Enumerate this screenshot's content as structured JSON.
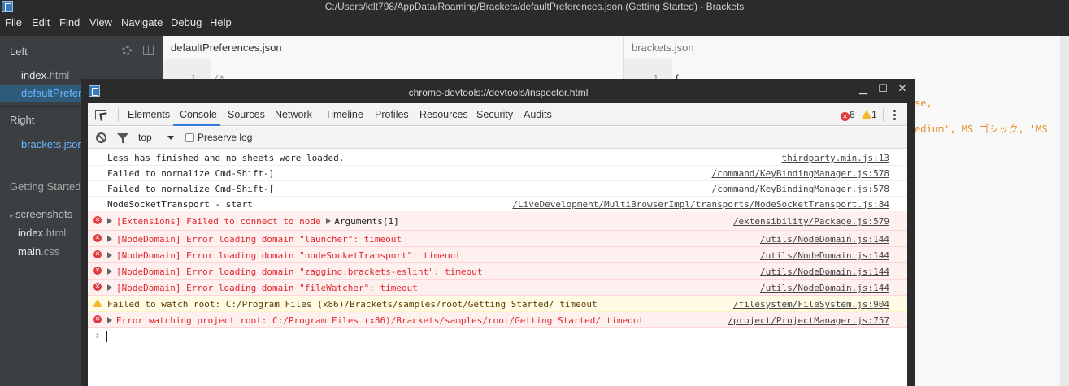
{
  "app": {
    "window_title": "C:/Users/ktlt798/AppData/Roaming/Brackets/defaultPreferences.json (Getting Started) - Brackets",
    "menu": [
      "File",
      "Edit",
      "Find",
      "View",
      "Navigate",
      "Debug",
      "Help"
    ]
  },
  "sidebar": {
    "left_header": "Left",
    "left_files": [
      {
        "name": "index",
        "ext": ".html"
      },
      {
        "name": "defaultPrefer",
        "ext": ""
      }
    ],
    "right_header": "Right",
    "right_files": [
      {
        "name": "brackets.json",
        "ext": ""
      }
    ],
    "project_name": "Getting Started",
    "tree": [
      {
        "name": "screenshots",
        "ext": ""
      },
      {
        "name": "index",
        "ext": ".html"
      },
      {
        "name": "main",
        "ext": ".css"
      }
    ]
  },
  "editor": {
    "left_tab": "defaultPreferences.json",
    "right_tab": "brackets.json",
    "left_line_number": "1",
    "left_code_start": "/*",
    "right_line_number": "1",
    "right_code_start": "{",
    "right_snippet_1": "se,",
    "right_snippet_2": "edium', MS ゴシック, 'MS"
  },
  "devtools": {
    "title": "chrome-devtools://devtools/inspector.html",
    "window_buttons": {
      "minimize": "▁",
      "maximize": "☐",
      "close": "✕"
    },
    "tabs": [
      "Elements",
      "Console",
      "Sources",
      "Network",
      "Timeline",
      "Profiles",
      "Resources",
      "Security",
      "Audits"
    ],
    "active_tab": "Console",
    "error_count": "6",
    "warning_count": "1",
    "context": "top",
    "preserve_log_label": "Preserve log",
    "messages": [
      {
        "level": "log",
        "text": "Less has finished and no sheets were loaded.",
        "source": "thirdparty.min.js:13"
      },
      {
        "level": "log",
        "text": "Failed to normalize Cmd-Shift-]",
        "source": "/command/KeyBindingManager.js:578"
      },
      {
        "level": "log",
        "text": "Failed to normalize Cmd-Shift-[",
        "source": "/command/KeyBindingManager.js:578"
      },
      {
        "level": "log",
        "text": "NodeSocketTransport - start",
        "source": "/LiveDevelopment/MultiBrowserImpl/transports/NodeSocketTransport.js:84"
      },
      {
        "level": "error",
        "text": "[Extensions] Failed to connect to node",
        "extra": "Arguments[1]",
        "source": "/extensibility/Package.js:579"
      },
      {
        "level": "error",
        "text": "[NodeDomain] Error loading domain \"launcher\": timeout",
        "source": "/utils/NodeDomain.js:144"
      },
      {
        "level": "error",
        "text": "[NodeDomain] Error loading domain \"nodeSocketTransport\": timeout",
        "source": "/utils/NodeDomain.js:144"
      },
      {
        "level": "error",
        "text": "[NodeDomain] Error loading domain \"zaggino.brackets-eslint\": timeout",
        "source": "/utils/NodeDomain.js:144"
      },
      {
        "level": "error",
        "text": "[NodeDomain] Error loading domain \"fileWatcher\": timeout",
        "source": "/utils/NodeDomain.js:144"
      },
      {
        "level": "warning",
        "text": "Failed to watch root:  C:/Program Files (x86)/Brackets/samples/root/Getting Started/ timeout",
        "source": "/filesystem/FileSystem.js:904"
      },
      {
        "level": "error",
        "text": "Error watching project root:  C:/Program Files (x86)/Brackets/samples/root/Getting Started/ timeout",
        "source": "/project/ProjectManager.js:757"
      }
    ],
    "prompt": "›"
  }
}
